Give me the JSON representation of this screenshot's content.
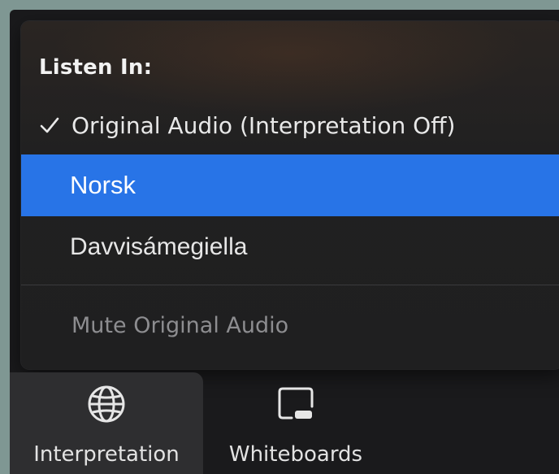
{
  "menu": {
    "header": "Listen In:",
    "items": [
      {
        "label": "Original Audio (Interpretation Off)",
        "checked": true,
        "icon": "checkmark-icon"
      },
      {
        "label": "Norsk",
        "highlighted": true
      },
      {
        "label": "Davvisámegiella"
      }
    ],
    "mute_label": "Mute Original Audio"
  },
  "toolbar": {
    "interpretation": {
      "label": "Interpretation",
      "icon": "globe-icon"
    },
    "whiteboards": {
      "label": "Whiteboards",
      "icon": "whiteboard-icon"
    }
  },
  "colors": {
    "highlight": "#2874e7",
    "menu_background": "#202021",
    "toolbar_background": "#1a1a1c",
    "page_border": "#7f9793",
    "disabled_text": "#8d8d90"
  }
}
